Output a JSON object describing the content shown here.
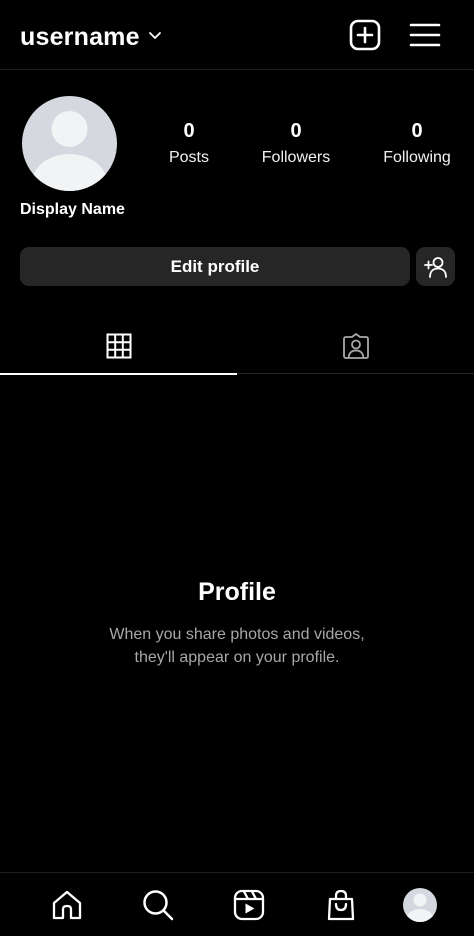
{
  "header": {
    "username": "username",
    "icons": [
      "chevron-down-icon",
      "create-plus-icon",
      "menu-icon"
    ]
  },
  "profile": {
    "display_name": "Display Name",
    "stats": [
      {
        "value": "0",
        "label": "Posts"
      },
      {
        "value": "0",
        "label": "Followers"
      },
      {
        "value": "0",
        "label": "Following"
      }
    ],
    "edit_label": "Edit profile"
  },
  "tabs": [
    {
      "icon": "grid-icon",
      "active": true
    },
    {
      "icon": "tagged-icon",
      "active": false
    }
  ],
  "empty_state": {
    "title": "Profile",
    "line1": "When you share photos and videos,",
    "line2": "they'll appear on your profile."
  },
  "bottom_nav": [
    "home-icon",
    "search-icon",
    "reels-icon",
    "shop-icon",
    "profile-avatar"
  ],
  "colors": {
    "background": "#000000",
    "surface": "#262626",
    "avatar": "#d5d9df",
    "muted_text": "#a8a8a8"
  }
}
